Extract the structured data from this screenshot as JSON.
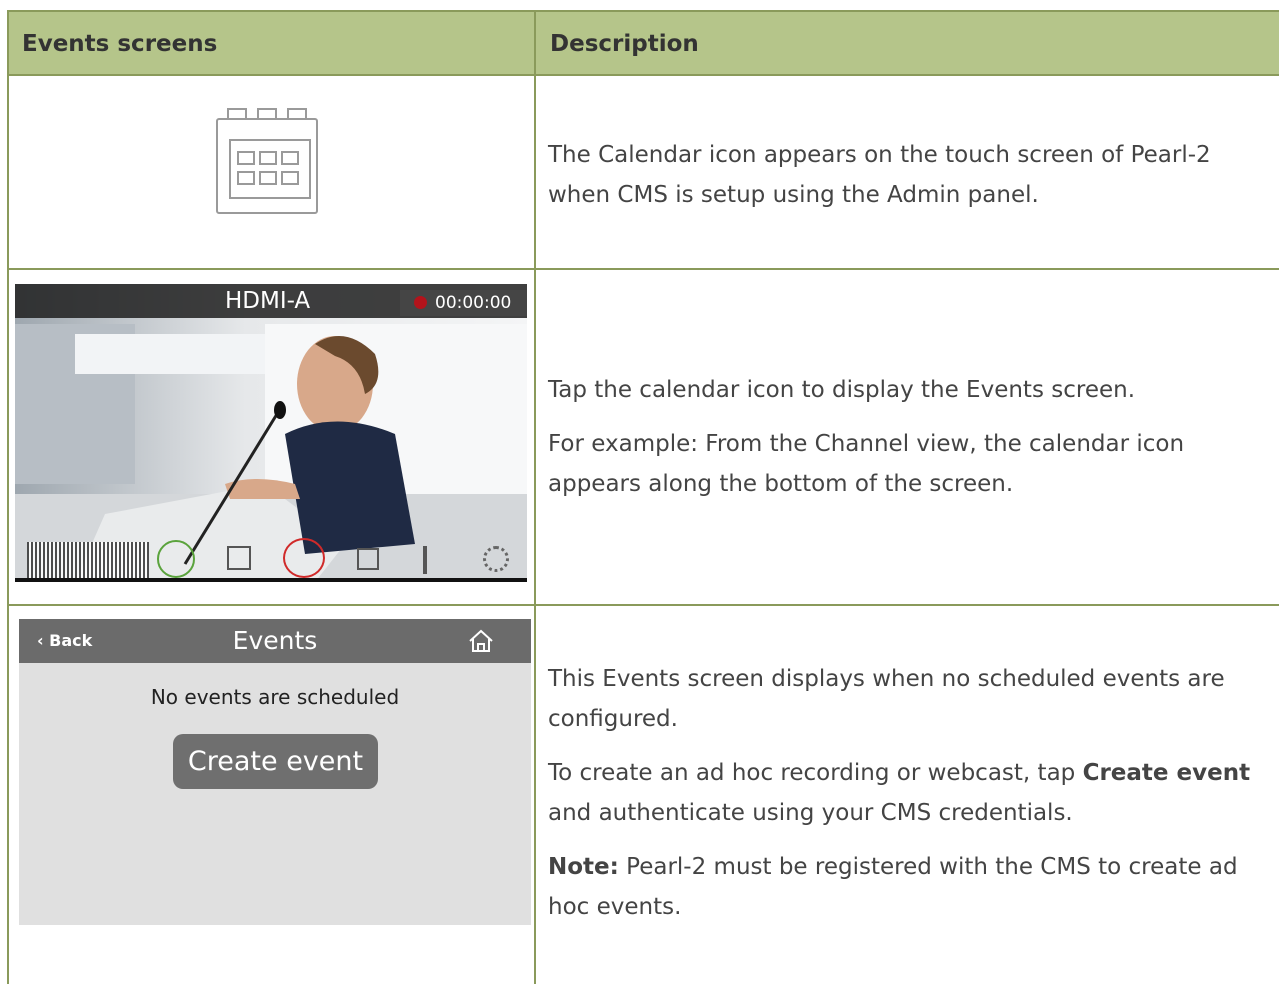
{
  "table": {
    "headers": [
      "Events screens",
      "Description"
    ]
  },
  "rows": {
    "row1": {
      "icon": "calendar-icon",
      "text": "The Calendar icon appears on the touch screen of Pearl-2 when CMS is setup using the Admin panel."
    },
    "row2": {
      "screen": {
        "channel": "HDMI-A",
        "timer": "00:00:00",
        "icons": [
          "audio-meter-icon",
          "headphones-icon",
          "stop-icon",
          "calendar-icon",
          "layout-icon",
          "touch-icon",
          "gear-icon"
        ]
      },
      "p1": "Tap the calendar icon to display the Events screen.",
      "p2": "For example: From the Channel view, the calendar icon appears along the bottom of the screen."
    },
    "row3": {
      "screen": {
        "back": "Back",
        "title": "Events",
        "message": "No events are scheduled",
        "button": "Create event"
      },
      "p1": "This Events screen displays when no scheduled events are configured.",
      "p2_pre": "To create an ad hoc recording or webcast, tap ",
      "p2_bold": "Create event",
      "p2_post": " and authenticate using your CMS credentials.",
      "p3_bold": "Note:",
      "p3_post": " Pearl-2 must be registered with the CMS to create ad hoc events."
    }
  },
  "colors": {
    "header_bg": "#b5c58a",
    "border": "#8a9a5b",
    "rec": "#b3131b"
  }
}
